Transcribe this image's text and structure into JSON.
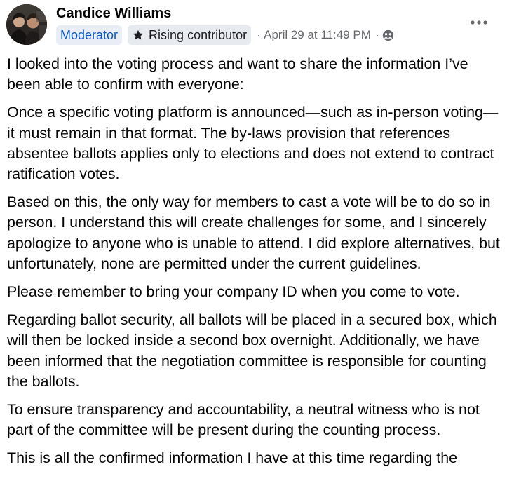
{
  "author": {
    "name": "Candice Williams",
    "avatar_icon": "profile-photo"
  },
  "badges": {
    "moderator": "Moderator",
    "rising": "Rising contributor",
    "rising_icon": "star-icon"
  },
  "meta": {
    "separator": "·",
    "timestamp": "April 29 at 11:49 PM",
    "audience_icon": "group-members-icon"
  },
  "menu": {
    "more_icon": "more-options-icon"
  },
  "colors": {
    "moderator_badge_text": "#0a5ac4",
    "badge_bg": "#e7ebf0",
    "secondary_text": "#65676b",
    "primary_text": "#050505"
  },
  "post": {
    "paragraphs": [
      "I looked into the voting process and want to share the information I’ve been able to confirm with everyone:",
      "Once a specific voting platform is announced—such as in-person voting—it must remain in that format. The by-laws provision that references absentee ballots applies only to elections and does not extend to contract ratification votes.",
      "Based on this, the only way for members to cast a vote will be to do so in person. I understand this will create challenges for some, and I sincerely apologize to anyone who is unable to attend. I did explore alternatives, but unfortunately, none are permitted under the current guidelines.",
      "Please remember to bring your company ID when you come to vote.",
      "Regarding ballot security, all ballots will be placed in a secured box, which will then be locked inside a second box overnight. Additionally, we have been informed that the negotiation committee is responsible for counting the ballots.",
      "To ensure transparency and accountability, a neutral witness who is not part of the committee will be present during the counting process.",
      "This is all the confirmed information I have at this time regarding the"
    ]
  }
}
